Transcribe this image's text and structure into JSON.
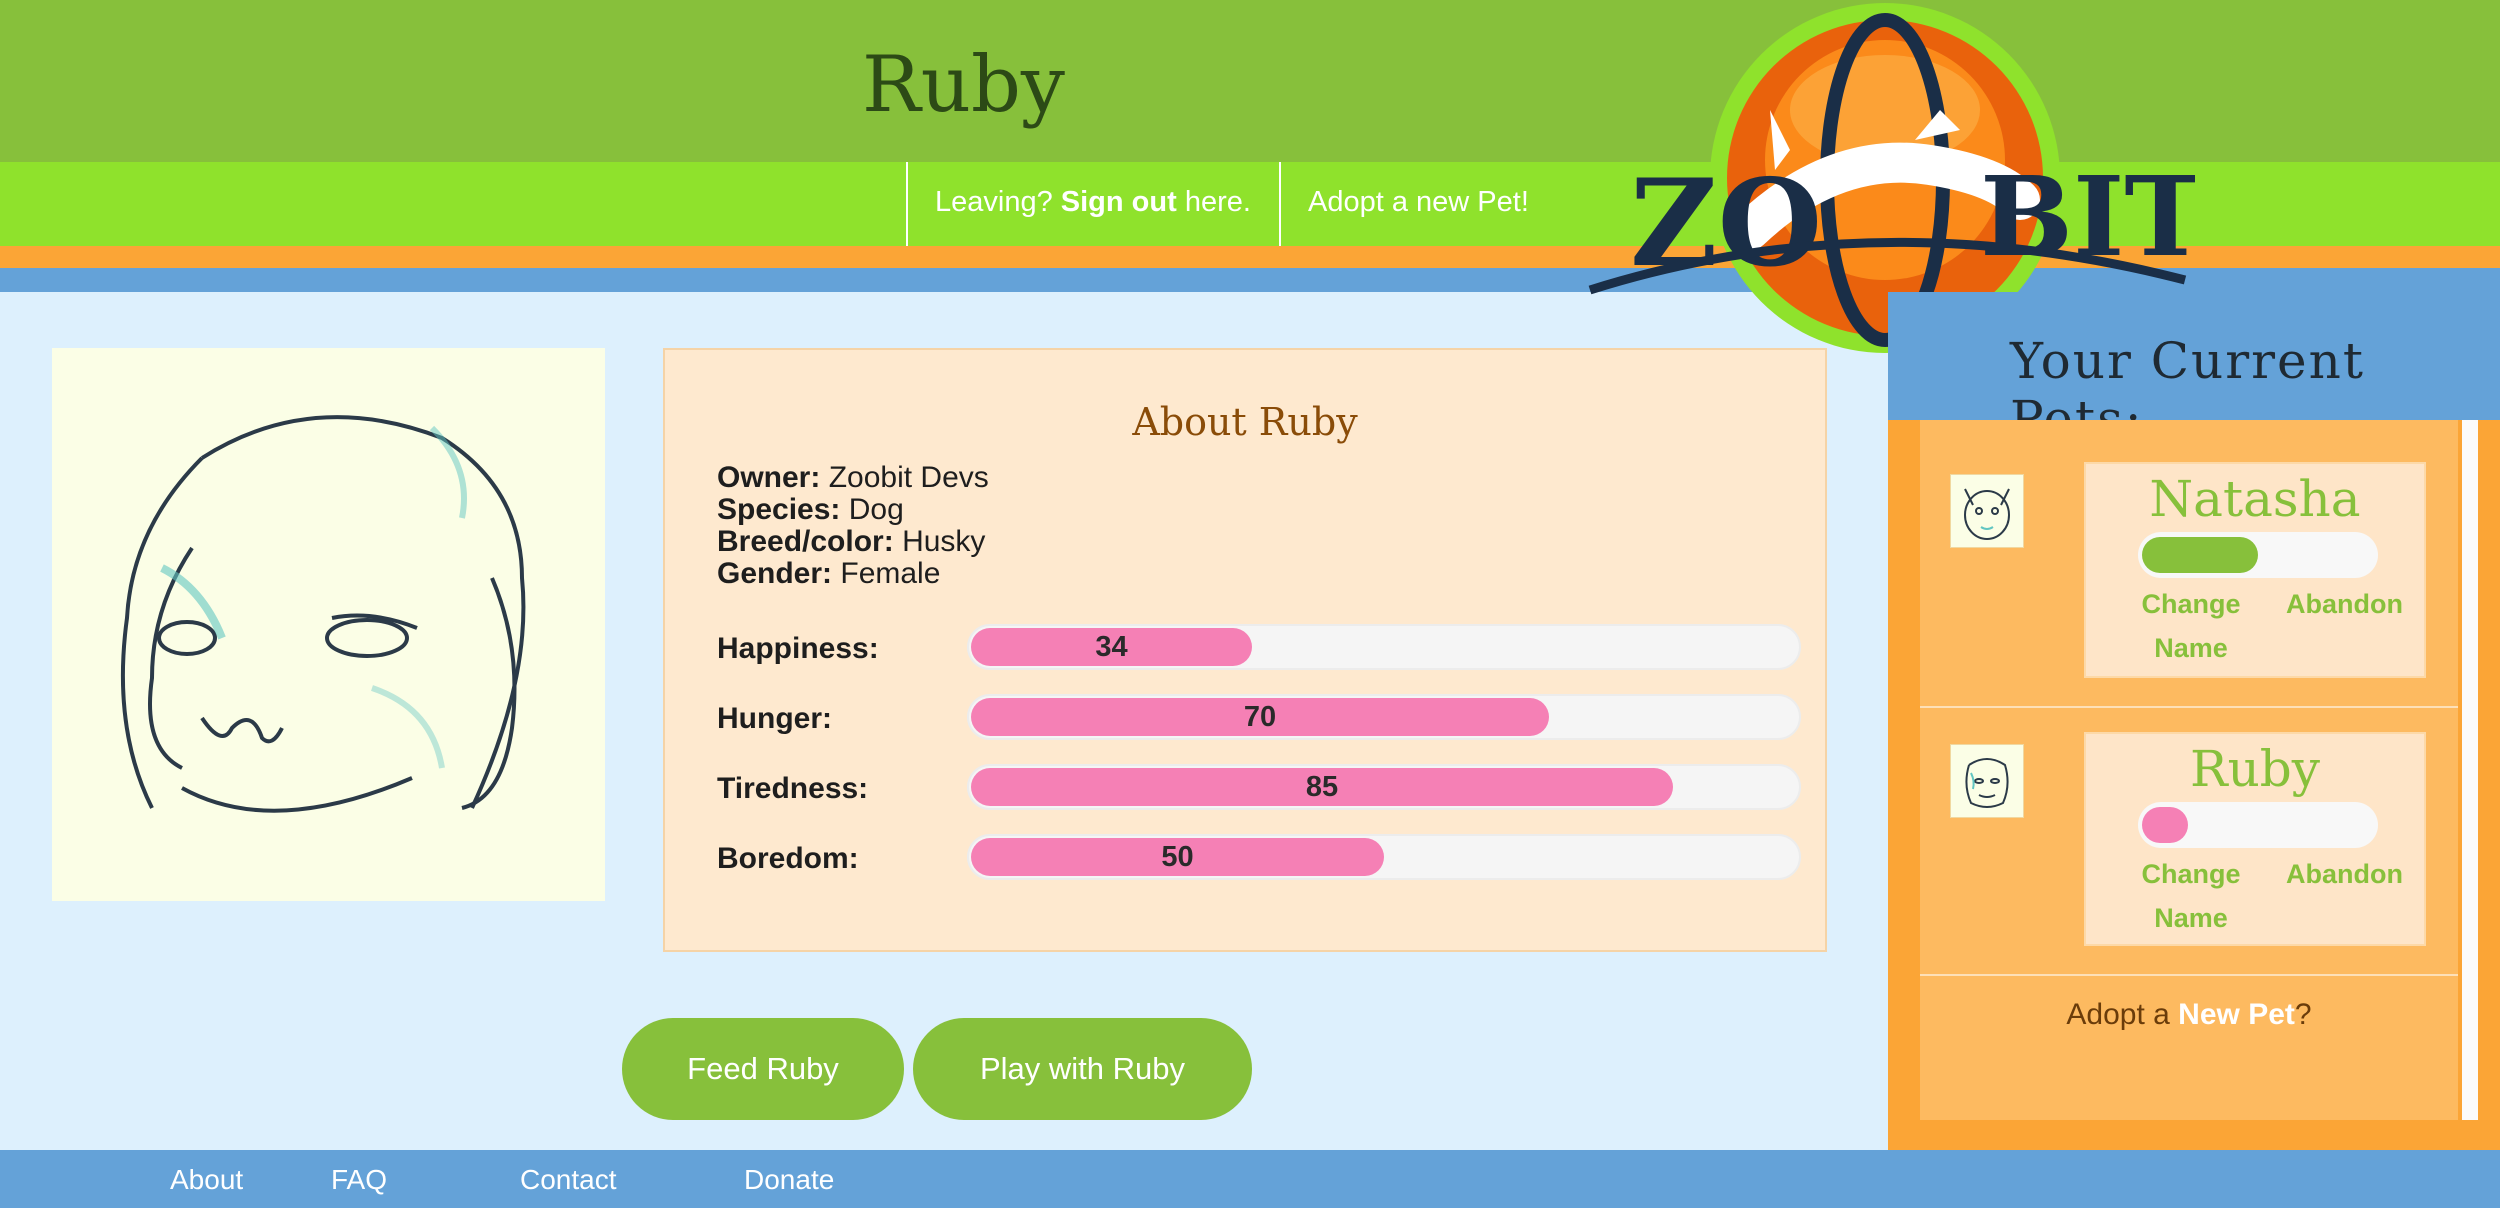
{
  "header": {
    "title": "Ruby",
    "signout": {
      "prefix": "Leaving? ",
      "link": "Sign out",
      "suffix": " here."
    },
    "adopt_link": "Adopt a new Pet!",
    "logo_text": "ZOOBIT"
  },
  "about": {
    "heading": "About Ruby",
    "info": [
      {
        "label": "Owner:",
        "value": "Zoobit Devs"
      },
      {
        "label": "Species:",
        "value": "Dog"
      },
      {
        "label": "Breed/color:",
        "value": "Husky"
      },
      {
        "label": "Gender:",
        "value": "Female"
      }
    ],
    "stats": [
      {
        "label": "Happiness:",
        "value": 34
      },
      {
        "label": "Hunger:",
        "value": 70
      },
      {
        "label": "Tiredness:",
        "value": 85
      },
      {
        "label": "Boredom:",
        "value": 50
      }
    ],
    "stat_fill_color": "#f580b5"
  },
  "actions": {
    "feed": "Feed Ruby",
    "play": "Play with Ruby"
  },
  "sidebar": {
    "title": "Your Current Pets:",
    "pets": [
      {
        "name": "Natasha",
        "level": 0.5,
        "bar_color": "#87c03b",
        "change_line1": "Change",
        "change_line2": "Name",
        "abandon": "Abandon",
        "icon": "cat-sketch-icon"
      },
      {
        "name": "Ruby",
        "level": 0.2,
        "bar_color": "#f580b5",
        "change_line1": "Change",
        "change_line2": "Name",
        "abandon": "Abandon",
        "icon": "dog-sketch-icon"
      }
    ],
    "adopt_prompt": {
      "prefix": "Adopt a ",
      "link": "New Pet",
      "suffix": "?"
    }
  },
  "footer": {
    "links": [
      "About",
      "FAQ",
      "Contact",
      "Donate"
    ]
  },
  "colors": {
    "green": "#87c03b",
    "bright_green": "#8fe22c",
    "orange": "#fba536",
    "blue": "#64a2d8",
    "pink": "#f580b5"
  }
}
